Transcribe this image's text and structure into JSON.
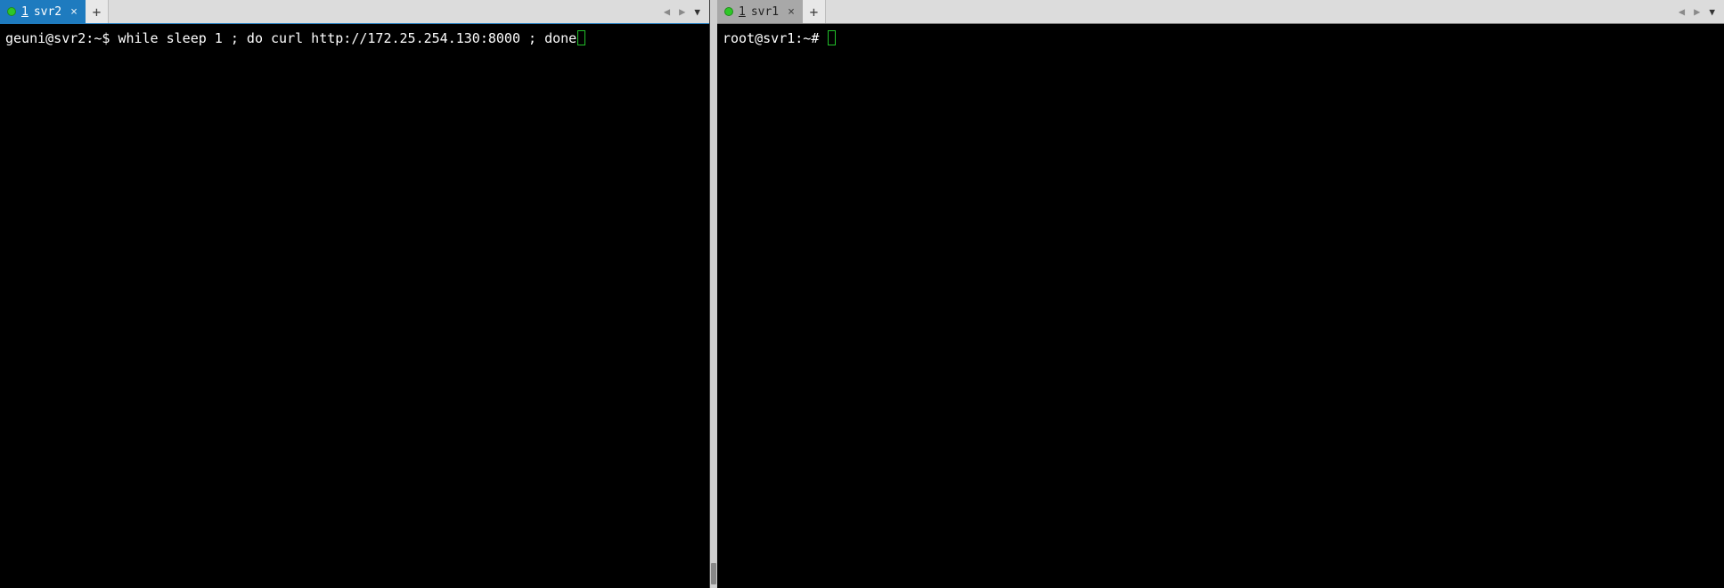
{
  "left": {
    "tab": {
      "num": "1",
      "label": "svr2",
      "dot_color": "dot-green"
    },
    "terminal": {
      "prompt": "geuni@svr2:~$ ",
      "command": "while sleep 1 ; do curl http://172.25.254.130:8000 ; done"
    }
  },
  "right": {
    "tab": {
      "num": "1",
      "label": "svr1",
      "dot_color": "dot-green"
    },
    "terminal": {
      "prompt": "root@svr1:~# ",
      "command": ""
    }
  },
  "icons": {
    "close": "×",
    "plus": "+",
    "left": "◀",
    "right": "▶",
    "dropdown": "▼"
  }
}
